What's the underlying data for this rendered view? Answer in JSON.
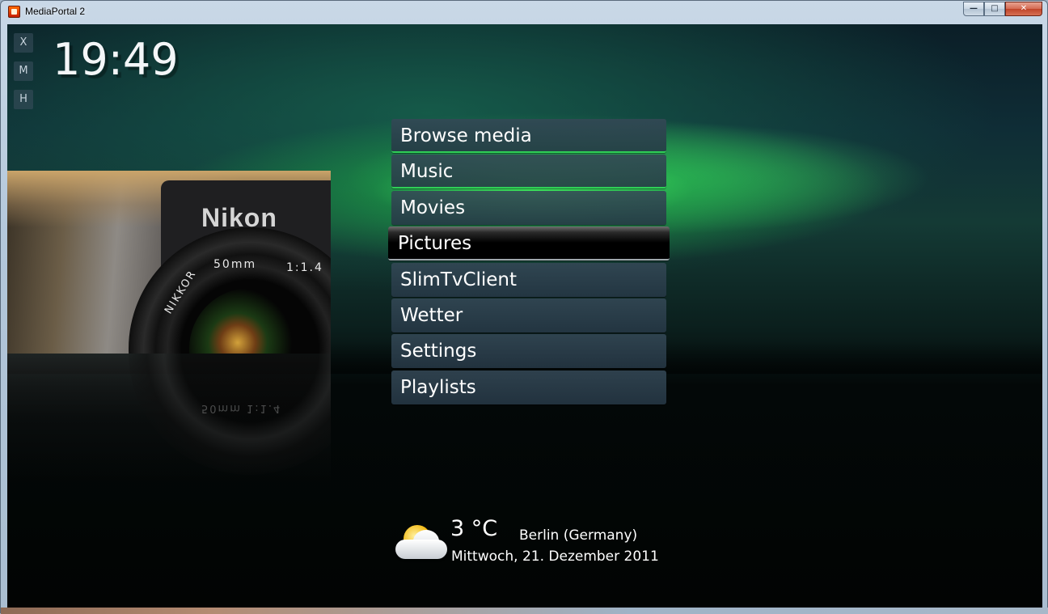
{
  "window": {
    "title": "MediaPortal 2",
    "buttons": {
      "minimize": "—",
      "maximize": "□",
      "close": "✕"
    }
  },
  "side_buttons": [
    "X",
    "M",
    "H"
  ],
  "clock": "19:49",
  "preview": {
    "brand": "Nikon",
    "lens_label_left": "50mm",
    "lens_label_right": "1:1.4",
    "lens_label_side": "NIKKOR",
    "reflection_text": "50mm 1:1.4"
  },
  "menu": {
    "items": [
      {
        "label": "Browse media"
      },
      {
        "label": "Music"
      },
      {
        "label": "Movies"
      },
      {
        "label": "Pictures",
        "selected": true
      },
      {
        "label": "SlimTvClient"
      },
      {
        "label": "Wetter"
      },
      {
        "label": "Settings"
      },
      {
        "label": "Playlists"
      }
    ]
  },
  "weather": {
    "icon": "partly-cloudy-icon",
    "temperature": "3 °C",
    "location": "Berlin (Germany)",
    "date": "Mittwoch, 21. Dezember 2011"
  },
  "colors": {
    "accent_green": "#2fcf57",
    "menu_bg": "#2c4352",
    "selected_bg": "#000000"
  }
}
